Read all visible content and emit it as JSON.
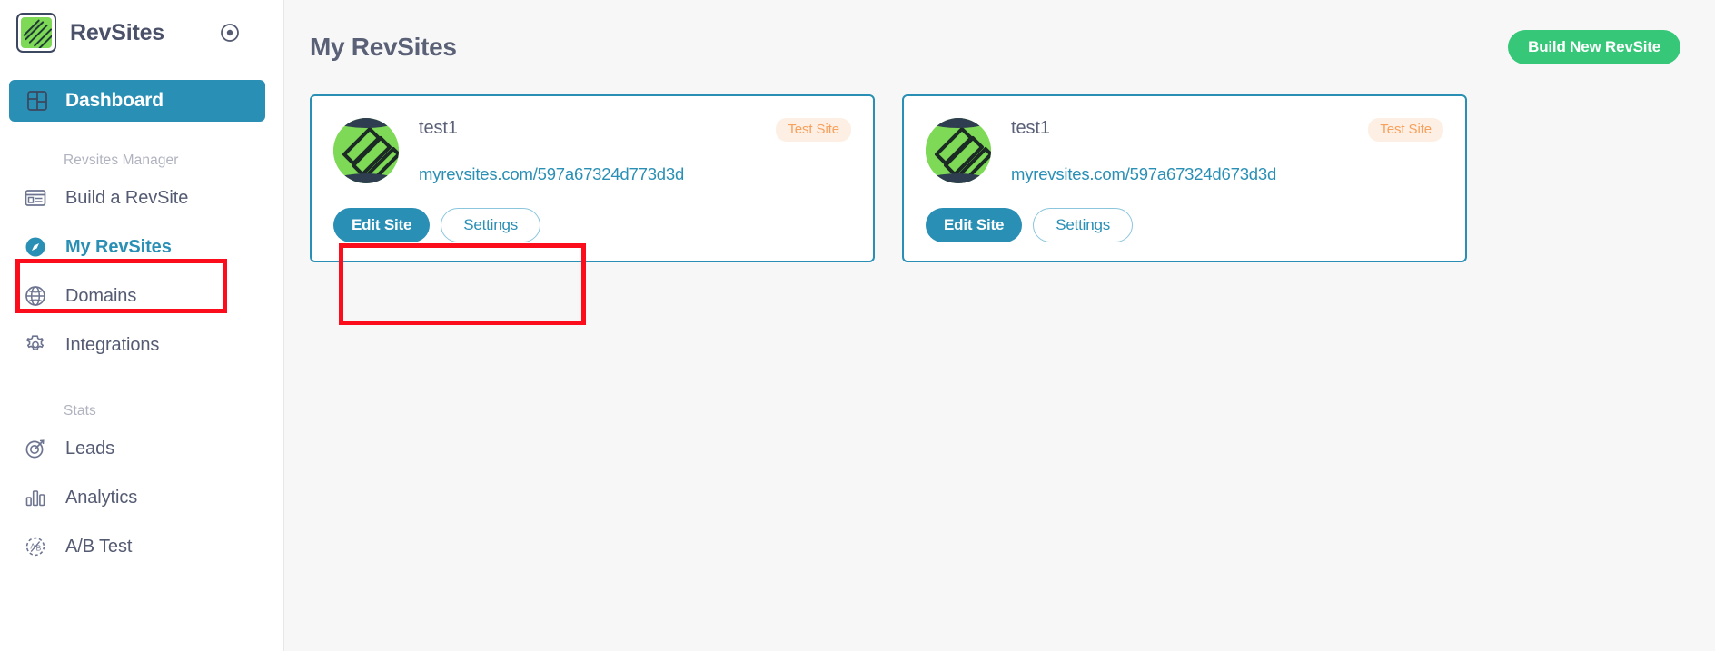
{
  "brand": {
    "name": "RevSites",
    "logo_icon": "revsites-logo-icon",
    "target_icon": "target-circle-icon"
  },
  "sidebar": {
    "active_item": {
      "label": "Dashboard",
      "icon": "dashboard-grid-icon"
    },
    "groups": [
      {
        "label": "Revsites Manager",
        "items": [
          {
            "label": "Build a RevSite",
            "icon": "browser-window-icon",
            "current": false
          },
          {
            "label": "My RevSites",
            "icon": "compass-icon",
            "current": true
          },
          {
            "label": "Domains",
            "icon": "globe-icon",
            "current": false
          },
          {
            "label": "Integrations",
            "icon": "gear-icon",
            "current": false
          }
        ]
      },
      {
        "label": "Stats",
        "items": [
          {
            "label": "Leads",
            "icon": "target-arrow-icon",
            "current": false
          },
          {
            "label": "Analytics",
            "icon": "bar-chart-icon",
            "current": false
          },
          {
            "label": "A/B Test",
            "icon": "ab-test-icon",
            "current": false
          }
        ]
      }
    ]
  },
  "header": {
    "title": "My RevSites",
    "build_button": "Build New RevSite"
  },
  "cards": [
    {
      "name": "test1",
      "url": "myrevsites.com/597a67324d773d3d",
      "badge": "Test Site",
      "edit_label": "Edit Site",
      "settings_label": "Settings",
      "avatar_icon": "revsites-site-avatar-icon"
    },
    {
      "name": "test1",
      "url": "myrevsites.com/597a67324d673d3d",
      "badge": "Test Site",
      "edit_label": "Edit Site",
      "settings_label": "Settings",
      "avatar_icon": "revsites-site-avatar-icon"
    }
  ],
  "colors": {
    "accent_teal": "#2a8fb5",
    "accent_green": "#36c878",
    "logo_green": "#7ed957",
    "badge_bg": "#fdefe3",
    "badge_text": "#f7a05c",
    "text_primary": "#5a6076",
    "highlight_red": "#fc0d1b",
    "page_bg": "#f7f7f8"
  }
}
